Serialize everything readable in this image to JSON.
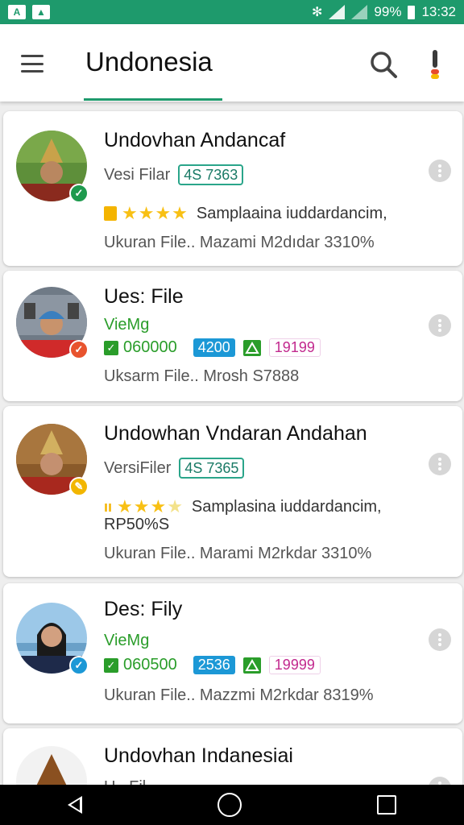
{
  "status_bar": {
    "left_icons": [
      "A",
      "▲"
    ],
    "battery": "99%",
    "time": "13:32"
  },
  "app_bar": {
    "title": "Undonesia"
  },
  "cards": [
    {
      "title": "Undovhan Andancaf",
      "version_label": "Vesi Filar",
      "version_code": "4S 7363",
      "rating_stars": 4,
      "description": "Samplaaina iuddardancim,",
      "footer": "Ukuran File.. Mazami M2dıdar 3310%",
      "badge_color": "#1e9a4e",
      "badge_icon": "check-icon"
    },
    {
      "title": "Ues: File",
      "subtitle": "VieMg",
      "stat_green": "060000",
      "stat_blue": "4200",
      "stat_pink": "19199",
      "footer": "Uksarm File.. Mrosh S7888",
      "badge_color": "#e8532e",
      "badge_icon": "check-icon"
    },
    {
      "title": "Undowhan Vndaran Andahan",
      "version_label": "VersiFiler",
      "version_code": "4S 7365",
      "rating_stars": 3.5,
      "description": "Samplasina iuddardancim,",
      "description2": "RP50%S",
      "footer": "Ukuran File.. Marami M2rkdar 3310%",
      "badge_color": "#f2b600",
      "badge_icon": "pencil-icon"
    },
    {
      "title": "Des: Fily",
      "subtitle": "VieMg",
      "stat_green": "060500",
      "stat_blue": "2536",
      "stat_pink": "19999",
      "footer": "Ukuran File.. Mazzmi M2rkdar 8319%",
      "badge_color": "#1c98d6",
      "badge_icon": "check-icon"
    },
    {
      "title": "Undovhan Indanesiai",
      "partial_label": "U...Fil..."
    }
  ],
  "colors": {
    "primary": "#1e9a6c",
    "star": "#f8c014",
    "blue_tag": "#1c98d6",
    "pink_tag": "#c2298e",
    "green_text": "#2a9d2a"
  },
  "nav_bar": {
    "icons": [
      "back-icon",
      "home-icon",
      "recents-icon"
    ]
  }
}
